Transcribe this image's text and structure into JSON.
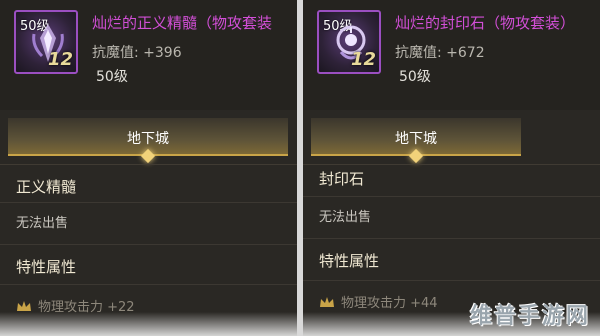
{
  "panels": [
    {
      "icon_level": "50级",
      "icon_badge": "12",
      "name": "灿烂的正义精髓（物攻套装",
      "stat": "抗魔值: +396",
      "level": "50级",
      "area": "地下城",
      "section_title": "正义精髓",
      "sell_text": "无法出售",
      "attr_title": "特性属性",
      "prop": "物理攻击力 +22"
    },
    {
      "icon_level": "50级",
      "icon_badge": "12",
      "name": "灿烂的封印石（物攻套装）",
      "stat": "抗魔值: +672",
      "level": "50级",
      "area": "地下城",
      "section_title": "封印石",
      "sell_text": "无法出售",
      "attr_title": "特性属性",
      "prop": "物理攻击力 +44"
    }
  ],
  "watermark": "维普手游网",
  "colors": {
    "item_name": "#d24fd7",
    "gold": "#c9a448",
    "panel_bg": "#2a2824"
  }
}
